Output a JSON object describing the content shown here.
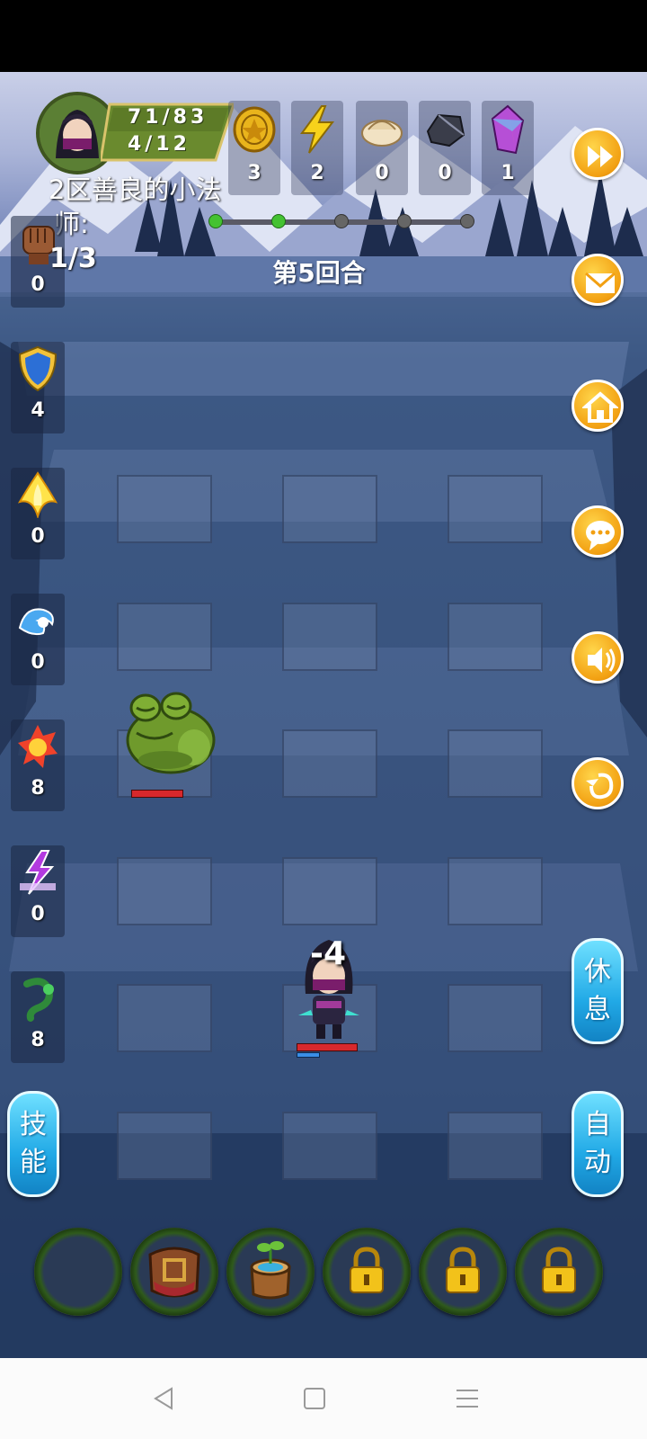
{
  "player": {
    "name_line1": "2区善良的小法",
    "name_line2": "师:",
    "hp": "71/83",
    "mp": "4/12"
  },
  "resources": [
    {
      "icon": "gold-coin-icon",
      "count": "3"
    },
    {
      "icon": "lightning-icon",
      "count": "2"
    },
    {
      "icon": "dumpling-icon",
      "count": "0"
    },
    {
      "icon": "ore-icon",
      "count": "0"
    },
    {
      "icon": "crystal-icon",
      "count": "1"
    }
  ],
  "progress": {
    "steps": 5,
    "completed": 2
  },
  "round_label": "第5回合",
  "attack_count": "1/3",
  "buffs": [
    {
      "icon": "fist-icon",
      "count": "0"
    },
    {
      "icon": "shield-icon",
      "count": "4"
    },
    {
      "icon": "holy-flame-icon",
      "count": "0"
    },
    {
      "icon": "water-wave-icon",
      "count": "0"
    },
    {
      "icon": "fire-burst-icon",
      "count": "8"
    },
    {
      "icon": "lightning-curse-icon",
      "count": "0"
    },
    {
      "icon": "poison-hook-icon",
      "count": "8"
    }
  ],
  "side_buttons": [
    "fast-forward-icon",
    "mail-icon",
    "home-icon",
    "chat-icon",
    "sound-icon",
    "return-icon"
  ],
  "actions": {
    "rest_label": "休息",
    "auto_label": "自动",
    "skill_label": "技能"
  },
  "combat": {
    "damage_text": "-4",
    "frog_hp": 1.0,
    "hero_hp": 1.0
  },
  "skill_slots": [
    {
      "state": "empty"
    },
    {
      "state": "item",
      "icon": "leather-belt-icon"
    },
    {
      "state": "item",
      "icon": "sprout-stump-icon"
    },
    {
      "state": "locked",
      "icon": "lock-icon"
    },
    {
      "state": "locked",
      "icon": "lock-icon"
    },
    {
      "state": "locked",
      "icon": "lock-icon"
    }
  ],
  "colors": {
    "gold_button": "#f2a012",
    "blue_button": "#21a9e6",
    "hp_red": "#d8282c",
    "progress_green": "#44c232"
  }
}
